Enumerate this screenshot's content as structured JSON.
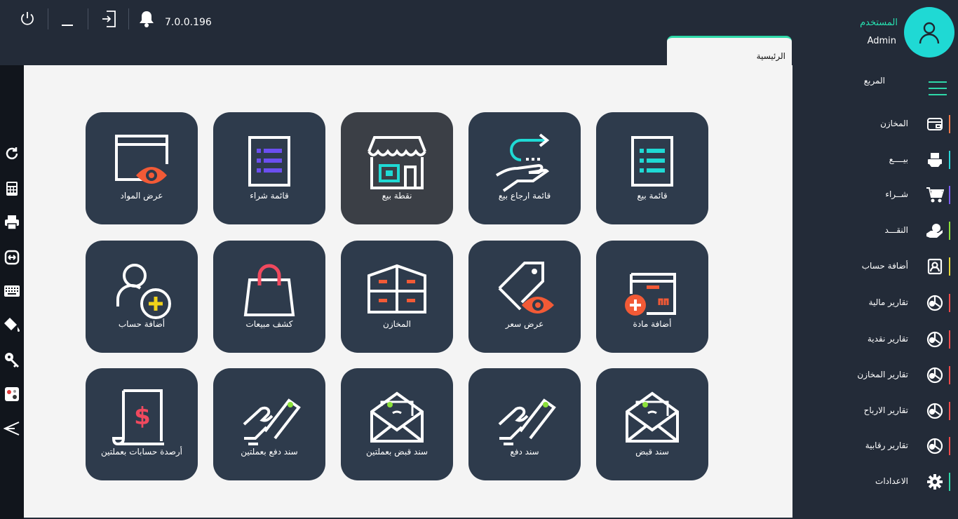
{
  "topbar": {
    "version": "7.0.0.196",
    "power_icon": "power-icon",
    "minimize_icon": "minimize-icon",
    "logout_icon": "logout-icon",
    "bell_icon": "bell-icon",
    "tab_label": "الرئيسية"
  },
  "user": {
    "role": "المستخدم",
    "name": "Admin"
  },
  "sidebar": {
    "menu_title": "المربع",
    "items": [
      {
        "label": "المخازن",
        "icon": "wallet-icon",
        "color": "#f07a4a"
      },
      {
        "label": "بيــــع",
        "icon": "cash-register-icon",
        "color": "#28d6d8"
      },
      {
        "label": "شــراء",
        "icon": "cart-icon",
        "color": "#7b5cf0"
      },
      {
        "label": "النقـــد",
        "icon": "hand-money-icon",
        "color": "#8be03a"
      },
      {
        "label": "أضافة حساب",
        "icon": "contact-card-icon",
        "color": "#e6d838"
      },
      {
        "label": "تقارير مالية",
        "icon": "report-chart-icon",
        "color": "#ef4a4a"
      },
      {
        "label": "تقارير نقدية",
        "icon": "report-chart-icon",
        "color": "#ef4a4a"
      },
      {
        "label": "تقارير المخازن",
        "icon": "report-chart-icon",
        "color": "#ef4a4a"
      },
      {
        "label": "تقارير الارباح",
        "icon": "report-chart-icon",
        "color": "#ef4a4a"
      },
      {
        "label": "تقارير رقابية",
        "icon": "report-chart-icon",
        "color": "#ef4a4a"
      },
      {
        "label": "الاعدادات",
        "icon": "gear-icon",
        "color": "#2ed8a8"
      }
    ]
  },
  "left_tools": [
    "refresh-icon",
    "calculator-icon",
    "printer-icon",
    "resize-icon",
    "keyboard-icon",
    "paint-bucket-icon",
    "key-icon",
    "game-icon",
    "send-icon"
  ],
  "tiles": [
    {
      "label": "قائمة بيع",
      "icon": "sale-list-icon"
    },
    {
      "label": "قائمة ارجاع بيع",
      "icon": "return-sale-icon"
    },
    {
      "label": "نقطة بيع",
      "icon": "store-icon"
    },
    {
      "label": "قائمة شراء",
      "icon": "purchase-list-icon"
    },
    {
      "label": "عرض المواد",
      "icon": "view-items-icon"
    },
    {
      "label": "أضافة مادة",
      "icon": "add-item-icon"
    },
    {
      "label": "عرض سعر",
      "icon": "price-tag-icon"
    },
    {
      "label": "المخازن",
      "icon": "warehouse-icon"
    },
    {
      "label": "كشف مبيعات",
      "icon": "shopping-bag-icon"
    },
    {
      "label": "أضافة حساب",
      "icon": "add-user-icon"
    },
    {
      "label": "سند قبض",
      "icon": "receipt-envelope-icon"
    },
    {
      "label": "سند دفع",
      "icon": "payment-hand-icon"
    },
    {
      "label": "سند قبض بعملتين",
      "icon": "receipt-envelope-icon"
    },
    {
      "label": "سند دفع بعملتين",
      "icon": "payment-hand-icon"
    },
    {
      "label": "أرصدة حسابات بعملتين",
      "icon": "balance-document-icon"
    }
  ]
}
